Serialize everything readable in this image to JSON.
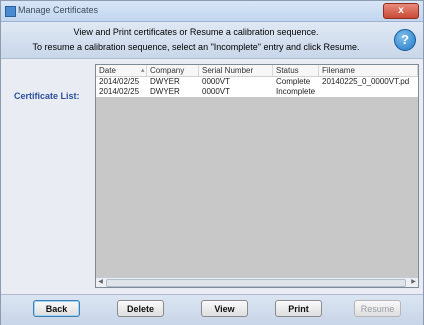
{
  "window": {
    "title": "Manage Certificates",
    "close_label": "x"
  },
  "header": {
    "line1": "View and Print certificates or Resume a calibration sequence.",
    "line2": "To resume a calibration sequence, select an \"Incomplete\" entry and click Resume.",
    "help_label": "?"
  },
  "certificate_list_label": "Certificate List:",
  "table": {
    "columns": [
      "Date",
      "Company",
      "Serial Number",
      "Status",
      "Filename"
    ],
    "rows": [
      [
        "2014/02/25",
        "DWYER",
        "0000VT",
        "Complete",
        "20140225_0_0000VT.pd"
      ],
      [
        "2014/02/25",
        "DWYER",
        "0000VT",
        "Incomplete",
        ""
      ]
    ]
  },
  "buttons": {
    "back": "Back",
    "delete": "Delete",
    "view": "View",
    "print": "Print",
    "resume": "Resume"
  }
}
